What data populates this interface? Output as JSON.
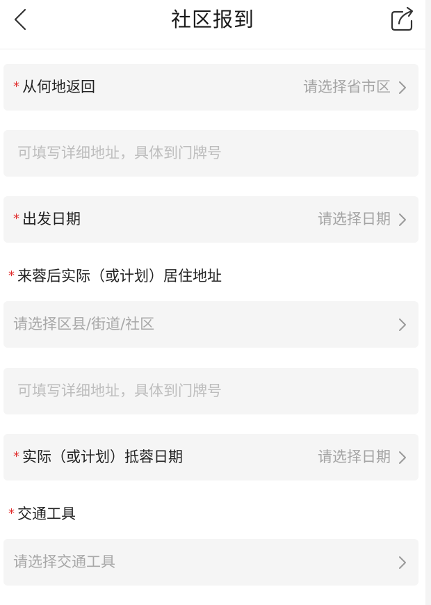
{
  "header": {
    "title": "社区报到"
  },
  "fields": {
    "origin": {
      "required_mark": "*",
      "label": "从何地返回",
      "value": "请选择省市区"
    },
    "origin_detail": {
      "placeholder": "可填写详细地址，具体到门牌号"
    },
    "departure_date": {
      "required_mark": "*",
      "label": "出发日期",
      "value": "请选择日期"
    },
    "residence_section": {
      "required_mark": "*",
      "label": "来蓉后实际（或计划）居住地址"
    },
    "residence_area": {
      "placeholder": "请选择区县/街道/社区"
    },
    "residence_detail": {
      "placeholder": "可填写详细地址，具体到门牌号"
    },
    "arrival_date": {
      "required_mark": "*",
      "label": "实际（或计划）抵蓉日期",
      "value": "请选择日期"
    },
    "transport_section": {
      "required_mark": "*",
      "label": "交通工具"
    },
    "transport": {
      "placeholder": "请选择交通工具"
    }
  },
  "icons": {
    "back": "chevron-left-icon",
    "share": "share-icon",
    "chevron": "chevron-right-icon"
  },
  "colors": {
    "required": "#e02b2b",
    "field_background": "#f5f5f5",
    "placeholder": "#a3a3a3"
  }
}
